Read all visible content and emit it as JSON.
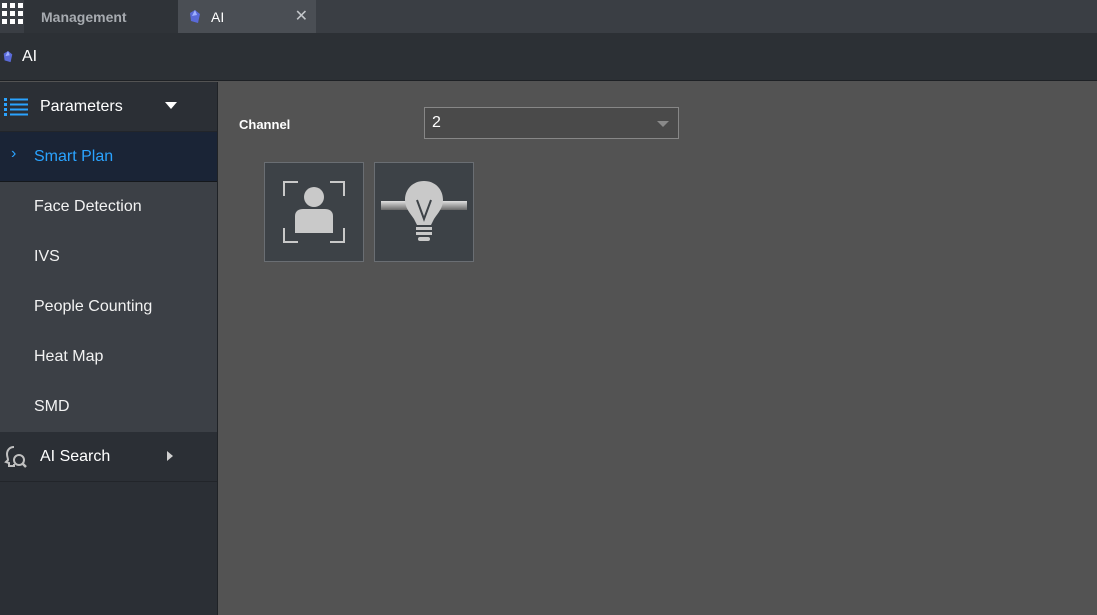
{
  "tabs": [
    {
      "label": "Management",
      "active": false
    },
    {
      "label": "AI",
      "active": true
    }
  ],
  "tab_close_glyph": "✕",
  "header": {
    "title": "AI"
  },
  "sidebar": {
    "parameters": {
      "label": "Parameters",
      "icon": "list-icon",
      "expanded": true
    },
    "items": [
      {
        "label": "Smart Plan",
        "active": true
      },
      {
        "label": "Face Detection"
      },
      {
        "label": "IVS"
      },
      {
        "label": "People Counting"
      },
      {
        "label": "Heat Map"
      },
      {
        "label": "SMD"
      }
    ],
    "ai_search": {
      "label": "AI Search",
      "icon": "face-search-icon",
      "expanded": false
    }
  },
  "content": {
    "channel": {
      "label": "Channel",
      "value": "2"
    },
    "plans": [
      {
        "name": "Face Detection",
        "icon": "face-detection-icon"
      },
      {
        "name": "IVS",
        "icon": "ivs-bulb-icon"
      }
    ]
  },
  "colors": {
    "accent": "#2aa3ff",
    "sidebar_bg": "#2b2f35",
    "active_item_bg": "#1a2436",
    "content_bg": "#535353"
  }
}
